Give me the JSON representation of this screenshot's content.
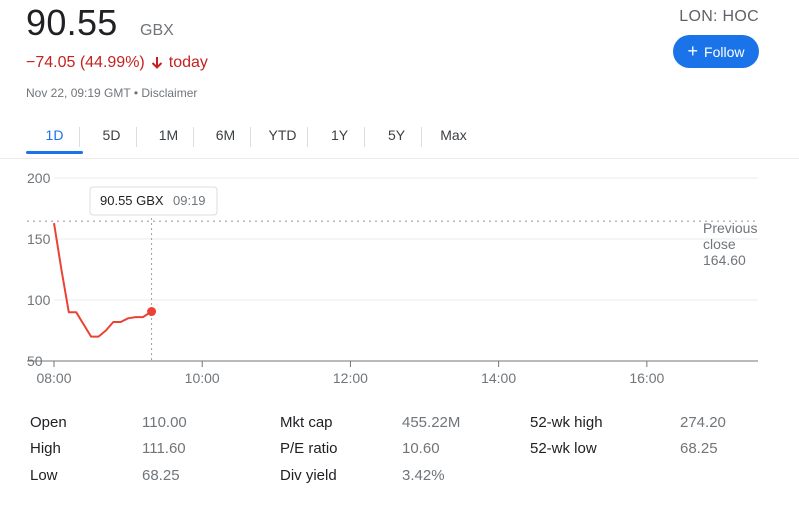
{
  "quote": {
    "price": "90.55",
    "currency": "GBX",
    "change": "−74.05 (44.99%)",
    "change_period": "today",
    "timestamp": "Nov 22, 09:19 GMT",
    "disclaimer": "Disclaimer",
    "ticker": "LON: HOC",
    "follow_label": "Follow",
    "colors": {
      "down": "#c5221f",
      "accent": "#1a73e8"
    }
  },
  "tabs": [
    {
      "label": "1D",
      "active": true
    },
    {
      "label": "5D"
    },
    {
      "label": "1M"
    },
    {
      "label": "6M"
    },
    {
      "label": "YTD"
    },
    {
      "label": "1Y"
    },
    {
      "label": "5Y"
    },
    {
      "label": "Max"
    }
  ],
  "chart_data": {
    "type": "line",
    "x": [
      "08:00",
      "08:06",
      "08:12",
      "08:18",
      "08:24",
      "08:30",
      "08:36",
      "08:42",
      "08:48",
      "08:54",
      "09:00",
      "09:06",
      "09:12",
      "09:19"
    ],
    "series": [
      {
        "values": [
          163,
          125,
          90,
          90,
          80,
          70,
          70,
          75,
          82,
          82,
          85,
          86,
          86,
          90.55
        ],
        "color": "#ea4335"
      }
    ],
    "y_ticks": [
      "200",
      "150",
      "100",
      "50"
    ],
    "x_ticks": [
      "08:00",
      "10:00",
      "12:00",
      "14:00",
      "16:00"
    ],
    "ylim": [
      50,
      200
    ],
    "xlim": [
      "08:00",
      "17:30"
    ],
    "previous_close": {
      "label": "Previous close",
      "value": "164.60"
    },
    "tooltip": {
      "price": "90.55 GBX",
      "time": "09:19"
    },
    "grid": true
  },
  "stats": [
    {
      "label": "Open",
      "value": "110.00"
    },
    {
      "label": "High",
      "value": "111.60"
    },
    {
      "label": "Low",
      "value": "68.25"
    },
    {
      "label": "Mkt cap",
      "value": "455.22M"
    },
    {
      "label": "P/E ratio",
      "value": "10.60"
    },
    {
      "label": "Div yield",
      "value": "3.42%"
    },
    {
      "label": "52-wk high",
      "value": "274.20"
    },
    {
      "label": "52-wk low",
      "value": "68.25"
    }
  ]
}
